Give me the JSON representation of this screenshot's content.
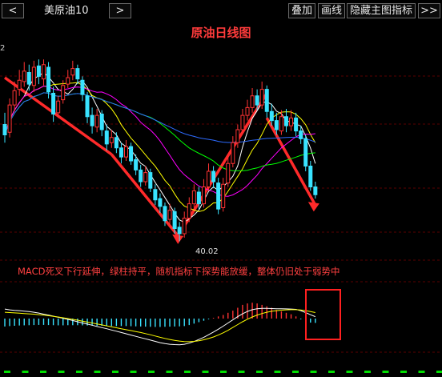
{
  "toolbar": {
    "prev_label": "<",
    "symbol": "美原油10",
    "next_label": ">",
    "overlay_label": "叠加",
    "draw_line_label": "画线",
    "hide_main_indicator_label": "隐藏主图指标",
    "more_label": ">>"
  },
  "axis_edge_label": "2",
  "chart_data": {
    "type": "candlestick",
    "title": "原油日线图",
    "low_label": "40.02",
    "annotation": "MACD死叉下行延伸，绿柱持平，随机指标下探势能放缓，整体仍旧处于弱势中",
    "candles": [
      {
        "o": 49.0,
        "c": 48.2,
        "h": 49.9,
        "l": 47.6
      },
      {
        "o": 48.4,
        "c": 50.5,
        "h": 51.0,
        "l": 48.0
      },
      {
        "o": 50.5,
        "c": 51.6,
        "h": 52.3,
        "l": 50.0
      },
      {
        "o": 51.7,
        "c": 52.4,
        "h": 53.2,
        "l": 51.2
      },
      {
        "o": 52.3,
        "c": 53.1,
        "h": 53.8,
        "l": 51.9
      },
      {
        "o": 53.0,
        "c": 52.1,
        "h": 53.6,
        "l": 51.6
      },
      {
        "o": 52.0,
        "c": 53.4,
        "h": 53.9,
        "l": 51.5
      },
      {
        "o": 53.5,
        "c": 52.7,
        "h": 54.0,
        "l": 52.1
      },
      {
        "o": 52.5,
        "c": 53.6,
        "h": 54.0,
        "l": 52.0
      },
      {
        "o": 53.4,
        "c": 51.5,
        "h": 53.8,
        "l": 51.0
      },
      {
        "o": 51.4,
        "c": 49.8,
        "h": 51.9,
        "l": 49.2
      },
      {
        "o": 49.9,
        "c": 50.8,
        "h": 51.2,
        "l": 49.5
      },
      {
        "o": 50.9,
        "c": 52.0,
        "h": 52.4,
        "l": 50.6
      },
      {
        "o": 52.1,
        "c": 52.6,
        "h": 53.2,
        "l": 51.8
      },
      {
        "o": 52.8,
        "c": 53.3,
        "h": 53.9,
        "l": 52.4
      },
      {
        "o": 53.3,
        "c": 52.5,
        "h": 53.6,
        "l": 52.1
      },
      {
        "o": 52.4,
        "c": 51.3,
        "h": 52.7,
        "l": 50.8
      },
      {
        "o": 51.2,
        "c": 49.6,
        "h": 51.5,
        "l": 49.1
      },
      {
        "o": 49.7,
        "c": 48.9,
        "h": 50.3,
        "l": 48.3
      },
      {
        "o": 48.8,
        "c": 49.7,
        "h": 50.2,
        "l": 48.4
      },
      {
        "o": 49.8,
        "c": 48.6,
        "h": 50.1,
        "l": 48.1
      },
      {
        "o": 48.5,
        "c": 47.5,
        "h": 49.0,
        "l": 47.0
      },
      {
        "o": 47.6,
        "c": 48.0,
        "h": 48.6,
        "l": 47.2
      },
      {
        "o": 48.0,
        "c": 47.2,
        "h": 48.4,
        "l": 46.8
      },
      {
        "o": 47.2,
        "c": 46.5,
        "h": 47.6,
        "l": 46.0
      },
      {
        "o": 46.5,
        "c": 47.3,
        "h": 47.8,
        "l": 46.2
      },
      {
        "o": 47.3,
        "c": 46.2,
        "h": 47.6,
        "l": 45.9
      },
      {
        "o": 46.3,
        "c": 45.5,
        "h": 46.7,
        "l": 45.1
      },
      {
        "o": 45.5,
        "c": 44.6,
        "h": 45.9,
        "l": 44.2
      },
      {
        "o": 44.6,
        "c": 45.3,
        "h": 45.8,
        "l": 44.3
      },
      {
        "o": 45.3,
        "c": 44.1,
        "h": 45.6,
        "l": 43.8
      },
      {
        "o": 44.0,
        "c": 43.2,
        "h": 44.4,
        "l": 42.8
      },
      {
        "o": 43.3,
        "c": 42.7,
        "h": 43.7,
        "l": 42.2
      },
      {
        "o": 42.7,
        "c": 41.6,
        "h": 43.0,
        "l": 41.2
      },
      {
        "o": 41.7,
        "c": 42.4,
        "h": 42.9,
        "l": 41.3
      },
      {
        "o": 42.3,
        "c": 41.0,
        "h": 42.6,
        "l": 40.6
      },
      {
        "o": 41.1,
        "c": 40.6,
        "h": 41.5,
        "l": 40.02
      },
      {
        "o": 40.6,
        "c": 41.8,
        "h": 42.3,
        "l": 40.3
      },
      {
        "o": 41.8,
        "c": 42.9,
        "h": 43.4,
        "l": 41.5
      },
      {
        "o": 42.9,
        "c": 43.9,
        "h": 44.4,
        "l": 42.6
      },
      {
        "o": 43.8,
        "c": 42.9,
        "h": 44.2,
        "l": 42.5
      },
      {
        "o": 42.9,
        "c": 44.2,
        "h": 44.8,
        "l": 42.6
      },
      {
        "o": 44.2,
        "c": 45.4,
        "h": 46.0,
        "l": 43.9
      },
      {
        "o": 45.4,
        "c": 44.6,
        "h": 45.8,
        "l": 44.1
      },
      {
        "o": 44.5,
        "c": 42.5,
        "h": 44.9,
        "l": 42.1
      },
      {
        "o": 42.6,
        "c": 44.4,
        "h": 44.9,
        "l": 42.3
      },
      {
        "o": 44.5,
        "c": 46.0,
        "h": 46.5,
        "l": 44.2
      },
      {
        "o": 46.0,
        "c": 47.6,
        "h": 48.1,
        "l": 45.7
      },
      {
        "o": 47.6,
        "c": 48.6,
        "h": 49.0,
        "l": 47.2
      },
      {
        "o": 48.6,
        "c": 49.7,
        "h": 50.2,
        "l": 48.3
      },
      {
        "o": 49.7,
        "c": 50.3,
        "h": 50.9,
        "l": 49.3
      },
      {
        "o": 50.3,
        "c": 51.2,
        "h": 51.8,
        "l": 49.9
      },
      {
        "o": 51.2,
        "c": 50.5,
        "h": 51.7,
        "l": 50.1
      },
      {
        "o": 50.5,
        "c": 51.7,
        "h": 52.3,
        "l": 50.2
      },
      {
        "o": 51.7,
        "c": 50.0,
        "h": 52.0,
        "l": 49.5
      },
      {
        "o": 50.0,
        "c": 49.3,
        "h": 50.6,
        "l": 48.9
      },
      {
        "o": 49.3,
        "c": 48.6,
        "h": 49.9,
        "l": 48.2
      },
      {
        "o": 48.5,
        "c": 49.6,
        "h": 50.1,
        "l": 48.2
      },
      {
        "o": 49.6,
        "c": 48.9,
        "h": 50.2,
        "l": 48.4
      },
      {
        "o": 48.9,
        "c": 49.5,
        "h": 50.1,
        "l": 48.5
      },
      {
        "o": 49.5,
        "c": 48.5,
        "h": 49.9,
        "l": 48.1
      },
      {
        "o": 48.5,
        "c": 47.9,
        "h": 48.9,
        "l": 47.5
      },
      {
        "o": 47.9,
        "c": 45.8,
        "h": 48.2,
        "l": 45.4
      },
      {
        "o": 45.8,
        "c": 44.2,
        "h": 46.2,
        "l": 43.9
      },
      {
        "o": 44.2,
        "c": 43.6,
        "h": 44.6,
        "l": 43.3
      }
    ],
    "moving_averages": [
      {
        "name": "MA5",
        "color": "#ffffff",
        "period": 5
      },
      {
        "name": "MA10",
        "color": "#ffff00",
        "period": 10
      },
      {
        "name": "MA20",
        "color": "#ff00ff",
        "period": 20
      },
      {
        "name": "MA30",
        "color": "#00ff00",
        "period": 30
      },
      {
        "name": "MA60",
        "color": "#2d6bff",
        "period": 60
      }
    ],
    "trend_lines": [
      {
        "from": 0,
        "to": 22,
        "y0": 52.6,
        "y1": 46.7
      },
      {
        "from": 22,
        "to": 36,
        "y0": 46.7,
        "y1": 40.3
      },
      {
        "from": 37,
        "to": 54,
        "y0": 41.2,
        "y1": 51.4
      },
      {
        "from": 54,
        "to": 64,
        "y0": 49.5,
        "y1": 42.8
      }
    ],
    "macd": {
      "histogram": [
        -0.55,
        -0.52,
        -0.5,
        -0.48,
        -0.47,
        -0.46,
        -0.45,
        -0.44,
        -0.44,
        -0.45,
        -0.46,
        -0.47,
        -0.47,
        -0.46,
        -0.46,
        -0.46,
        -0.47,
        -0.48,
        -0.49,
        -0.5,
        -0.5,
        -0.51,
        -0.52,
        -0.52,
        -0.52,
        -0.52,
        -0.53,
        -0.54,
        -0.55,
        -0.56,
        -0.57,
        -0.58,
        -0.58,
        -0.57,
        -0.56,
        -0.55,
        -0.54,
        -0.52,
        -0.45,
        -0.35,
        -0.25,
        -0.15,
        -0.05,
        0.05,
        0.15,
        0.25,
        0.4,
        0.55,
        0.75,
        0.95,
        1.05,
        1.1,
        1.05,
        0.95,
        0.85,
        0.75,
        0.6,
        0.5,
        0.4,
        0.3,
        0.15,
        -0.05,
        -0.2,
        -0.28,
        -0.3
      ],
      "dif": [
        0.6,
        0.55,
        0.52,
        0.5,
        0.47,
        0.44,
        0.4,
        0.35,
        0.28,
        0.22,
        0.15,
        0.08,
        0.02,
        -0.05,
        -0.12,
        -0.2,
        -0.28,
        -0.35,
        -0.42,
        -0.5,
        -0.57,
        -0.64,
        -0.72,
        -0.8,
        -0.88,
        -0.96,
        -1.04,
        -1.12,
        -1.2,
        -1.28,
        -1.36,
        -1.44,
        -1.52,
        -1.58,
        -1.62,
        -1.64,
        -1.65,
        -1.62,
        -1.55,
        -1.45,
        -1.32,
        -1.18,
        -1.02,
        -0.85,
        -0.67,
        -0.48,
        -0.28,
        -0.08,
        0.12,
        0.3,
        0.45,
        0.56,
        0.62,
        0.64,
        0.64,
        0.63,
        0.62,
        0.62,
        0.61,
        0.6,
        0.58,
        0.5,
        0.38,
        0.24,
        0.12
      ],
      "dea": [
        0.4,
        0.38,
        0.36,
        0.34,
        0.32,
        0.3,
        0.28,
        0.25,
        0.22,
        0.18,
        0.14,
        0.1,
        0.05,
        0.0,
        -0.05,
        -0.1,
        -0.16,
        -0.22,
        -0.28,
        -0.34,
        -0.4,
        -0.46,
        -0.52,
        -0.58,
        -0.64,
        -0.7,
        -0.76,
        -0.82,
        -0.88,
        -0.95,
        -1.02,
        -1.1,
        -1.18,
        -1.25,
        -1.32,
        -1.38,
        -1.42,
        -1.45,
        -1.46,
        -1.44,
        -1.4,
        -1.34,
        -1.26,
        -1.16,
        -1.04,
        -0.9,
        -0.74,
        -0.56,
        -0.38,
        -0.2,
        -0.04,
        0.1,
        0.22,
        0.32,
        0.4,
        0.46,
        0.5,
        0.53,
        0.55,
        0.56,
        0.56,
        0.54,
        0.5,
        0.44,
        0.38
      ]
    }
  },
  "colors": {
    "up": "#ff3333",
    "down": "#39e3ff",
    "trend": "#ff2a2a",
    "highlight_box": "#ff2020",
    "dif": "#ffffff",
    "dea": "#ffff00",
    "grid": "#5a0000",
    "bottom_bar": "#00dd00"
  }
}
